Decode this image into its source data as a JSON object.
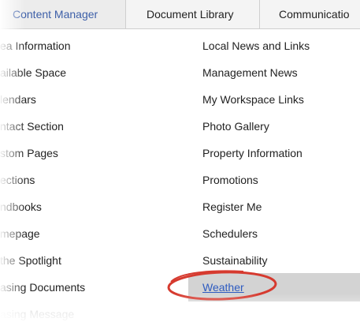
{
  "tabs": [
    {
      "label": "Content Manager"
    },
    {
      "label": "Document Library"
    },
    {
      "label": "Communicatio"
    }
  ],
  "left_menu": [
    {
      "label": "ea Information"
    },
    {
      "label": "ailable Space"
    },
    {
      "label": "lendars"
    },
    {
      "label": "ntact Section"
    },
    {
      "label": "stom Pages"
    },
    {
      "label": "ections"
    },
    {
      "label": "ndbooks"
    },
    {
      "label": "mepage"
    },
    {
      "label": "the Spotlight"
    },
    {
      "label": "asing Documents"
    },
    {
      "label": "asing Message"
    }
  ],
  "right_menu": [
    {
      "label": "Local News and Links"
    },
    {
      "label": "Management News"
    },
    {
      "label": "My Workspace Links"
    },
    {
      "label": "Photo Gallery"
    },
    {
      "label": "Property Information"
    },
    {
      "label": "Promotions"
    },
    {
      "label": "Register Me"
    },
    {
      "label": "Schedulers"
    },
    {
      "label": "Sustainability"
    },
    {
      "label": "Weather"
    }
  ],
  "colors": {
    "active_tab_text": "#3d5fa8",
    "link": "#2e5bc0",
    "highlight_row": "#d3d3d3",
    "annotation_ring": "#d63a2f"
  }
}
